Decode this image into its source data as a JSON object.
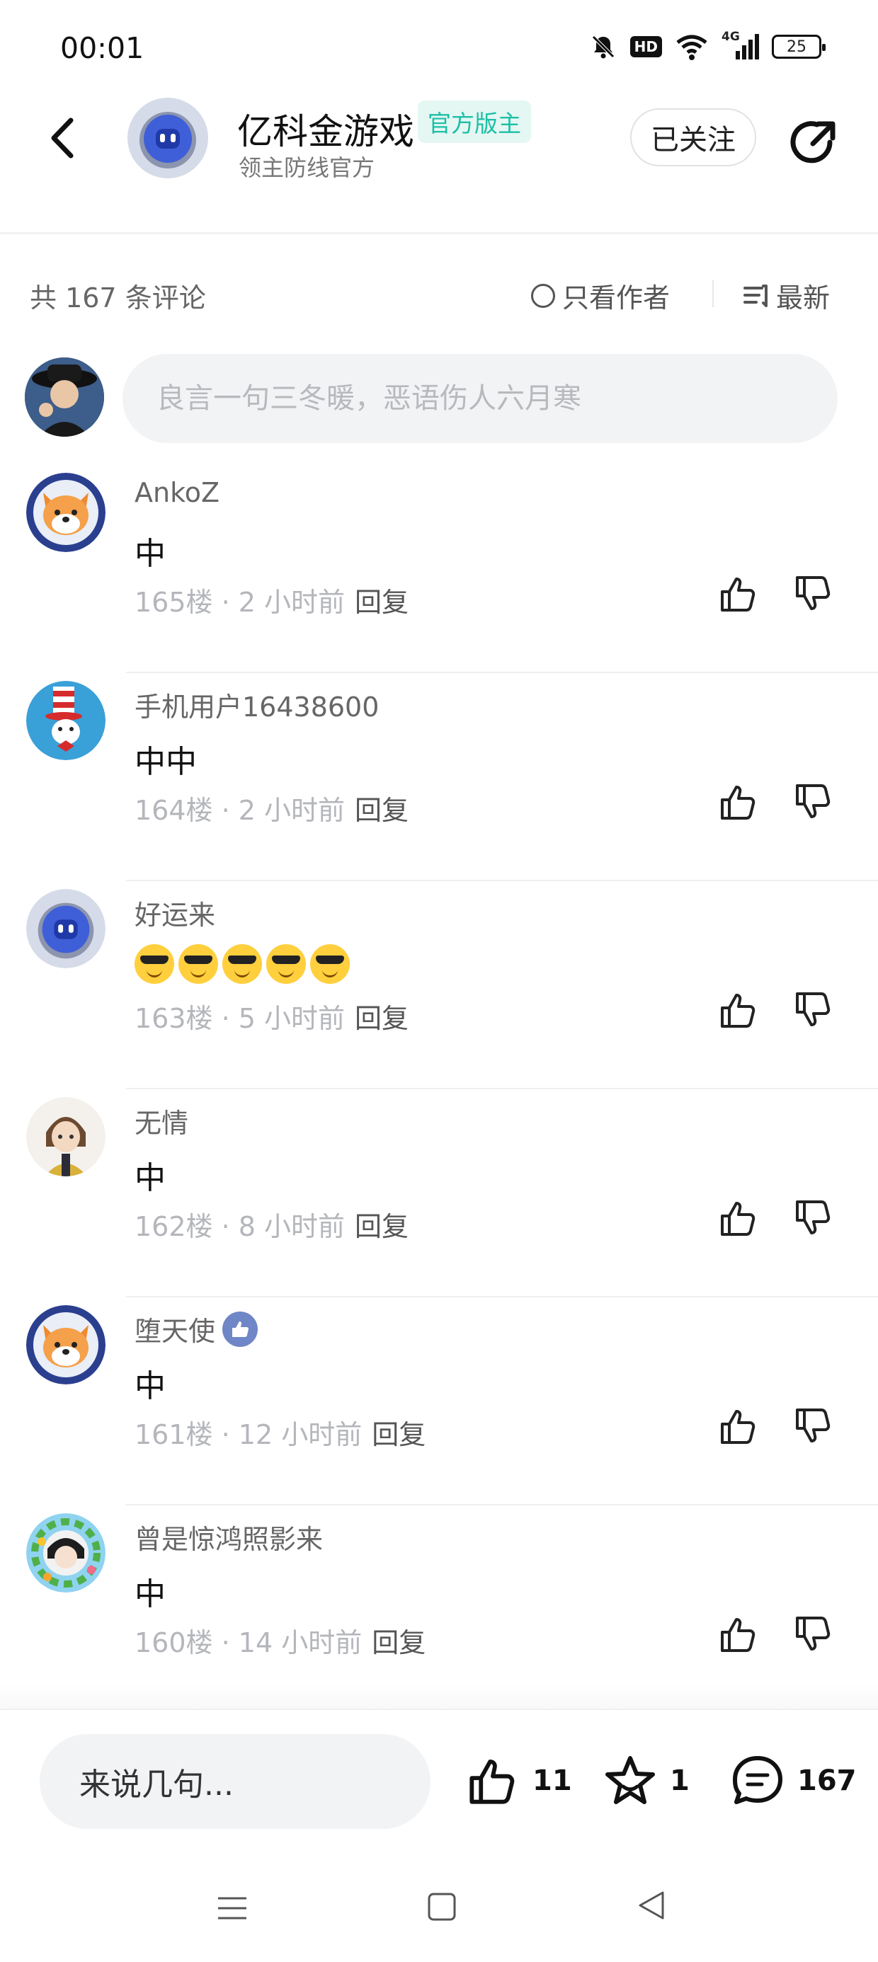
{
  "status_bar": {
    "time": "00:01",
    "network": "4G",
    "hd_label": "HD",
    "battery": "25"
  },
  "header": {
    "name": "亿科金游戏",
    "badge": "官方版主",
    "subtitle": "领主防线官方",
    "follow_label": "已关注"
  },
  "toolbar": {
    "comment_count": "共 167 条评论",
    "author_only": "只看作者",
    "sort": "最新"
  },
  "comment_input": {
    "placeholder": "良言一句三冬暖，恶语伤人六月寒"
  },
  "comments": [
    {
      "user": "AnkoZ",
      "text": "中",
      "meta": "165楼 · 2 小时前",
      "reply": "回复",
      "avatar": "shiba-avatar"
    },
    {
      "user": "手机用户16438600",
      "text": "中中",
      "meta": "164楼 · 2 小时前",
      "reply": "回复",
      "avatar": "cat-in-hat-avatar"
    },
    {
      "user": "好运来",
      "text": "",
      "meta": "163楼 · 5 小时前",
      "reply": "回复",
      "avatar": "robot-avatar",
      "emojis": [
        "cool-face",
        "cool-face",
        "cool-face",
        "cool-face",
        "cool-face"
      ]
    },
    {
      "user": "无情",
      "text": "中",
      "meta": "162楼 · 8 小时前",
      "reply": "回复",
      "avatar": "anime-girl-avatar"
    },
    {
      "user": "堕天使",
      "text": "中",
      "meta": "161楼 · 12 小时前",
      "reply": "回复",
      "avatar": "shiba-avatar",
      "badge": "thumbs-up-badge"
    },
    {
      "user": "曾是惊鸿照影来",
      "text": "中",
      "meta": "160楼 · 14 小时前",
      "reply": "回复",
      "avatar": "floral-avatar"
    }
  ],
  "bottom_bar": {
    "input_placeholder": "来说几句...",
    "like_count": "11",
    "fav_count": "1",
    "comment_count": "167"
  },
  "colors": {
    "badge_text": "#1dbfa6",
    "badge_bg": "#e4f7f3",
    "muted_text": "#b4b6bb",
    "like_badge": "#6f86c7"
  }
}
